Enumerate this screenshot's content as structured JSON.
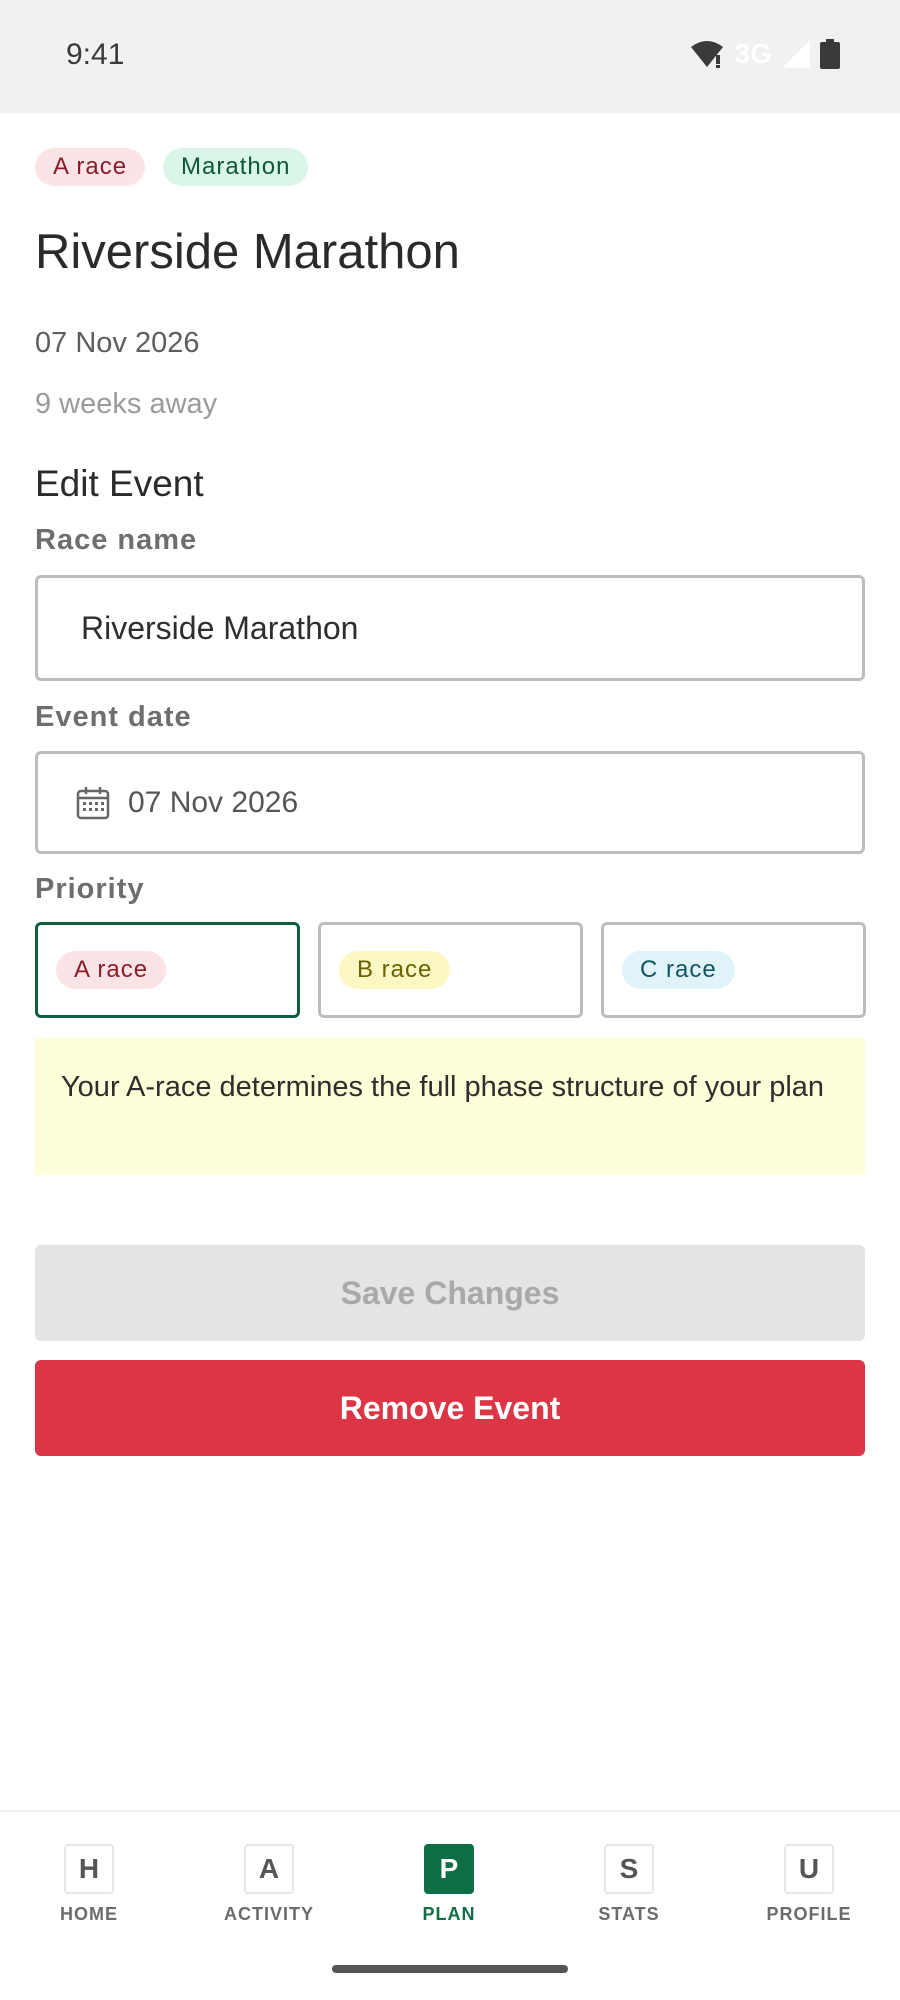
{
  "status_bar": {
    "time": "9:41",
    "network": "3G"
  },
  "tags": {
    "priority": "A race",
    "type": "Marathon"
  },
  "race": {
    "title": "Riverside Marathon",
    "date": "07 Nov 2026",
    "countdown": "9 weeks away"
  },
  "form": {
    "section_title": "Edit Event",
    "race_name_label": "Race name",
    "race_name_value": "Riverside Marathon",
    "event_date_label": "Event date",
    "event_date_value": "07 Nov 2026",
    "priority_label": "Priority",
    "priority_options": [
      "A race",
      "B race",
      "C race"
    ],
    "priority_selected": "A race",
    "info_text": "Your A-race determines the full phase structure of your plan"
  },
  "buttons": {
    "save": "Save Changes",
    "remove": "Remove Event"
  },
  "nav": {
    "items": [
      {
        "icon": "H",
        "label": "HOME"
      },
      {
        "icon": "A",
        "label": "ACTIVITY"
      },
      {
        "icon": "P",
        "label": "PLAN"
      },
      {
        "icon": "S",
        "label": "STATS"
      },
      {
        "icon": "U",
        "label": "PROFILE"
      }
    ],
    "active": "PLAN"
  },
  "colors": {
    "brand_green": "#0f6e45",
    "danger_red": "#dc3545",
    "info_bg": "#fefed8"
  }
}
